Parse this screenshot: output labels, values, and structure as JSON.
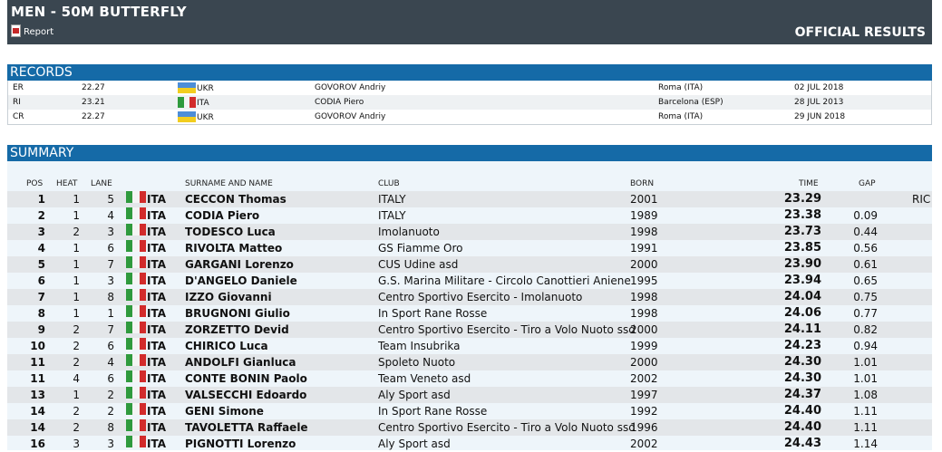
{
  "header": {
    "title": "MEN - 50M BUTTERFLY",
    "report_label": "Report",
    "official_label": "OFFICIAL RESULTS"
  },
  "records": {
    "title": "RECORDS",
    "rows": [
      {
        "type": "ER",
        "time": "22.27",
        "nat": "UKR",
        "name": "GOVOROV Andriy",
        "place": "Roma (ITA)",
        "date": "02 JUL 2018"
      },
      {
        "type": "RI",
        "time": "23.21",
        "nat": "ITA",
        "name": "CODIA Piero",
        "place": "Barcelona (ESP)",
        "date": "28 JUL 2013"
      },
      {
        "type": "CR",
        "time": "22.27",
        "nat": "UKR",
        "name": "GOVOROV Andriy",
        "place": "Roma (ITA)",
        "date": "29 JUN 2018"
      }
    ]
  },
  "summary": {
    "title": "SUMMARY",
    "columns": {
      "pos": "POS",
      "heat": "HEAT",
      "lane": "LANE",
      "name": "SURNAME AND NAME",
      "club": "CLUB",
      "born": "BORN",
      "time": "TIME",
      "gap": "GAP"
    },
    "rows": [
      {
        "pos": "1",
        "heat": "1",
        "lane": "5",
        "nat": "ITA",
        "name": "CECCON Thomas",
        "club": "ITALY",
        "born": "2001",
        "time": "23.29",
        "gap": "",
        "note": "RIC"
      },
      {
        "pos": "2",
        "heat": "1",
        "lane": "4",
        "nat": "ITA",
        "name": "CODIA Piero",
        "club": "ITALY",
        "born": "1989",
        "time": "23.38",
        "gap": "0.09",
        "note": ""
      },
      {
        "pos": "3",
        "heat": "2",
        "lane": "3",
        "nat": "ITA",
        "name": "TODESCO Luca",
        "club": "Imolanuoto",
        "born": "1998",
        "time": "23.73",
        "gap": "0.44",
        "note": ""
      },
      {
        "pos": "4",
        "heat": "1",
        "lane": "6",
        "nat": "ITA",
        "name": "RIVOLTA Matteo",
        "club": "GS Fiamme Oro",
        "born": "1991",
        "time": "23.85",
        "gap": "0.56",
        "note": ""
      },
      {
        "pos": "5",
        "heat": "1",
        "lane": "7",
        "nat": "ITA",
        "name": "GARGANI Lorenzo",
        "club": "CUS Udine asd",
        "born": "2000",
        "time": "23.90",
        "gap": "0.61",
        "note": ""
      },
      {
        "pos": "6",
        "heat": "1",
        "lane": "3",
        "nat": "ITA",
        "name": "D'ANGELO Daniele",
        "club": "G.S. Marina Militare - Circolo Canottieri Aniene",
        "born": "1995",
        "time": "23.94",
        "gap": "0.65",
        "note": ""
      },
      {
        "pos": "7",
        "heat": "1",
        "lane": "8",
        "nat": "ITA",
        "name": "IZZO Giovanni",
        "club": "Centro Sportivo Esercito - Imolanuoto",
        "born": "1998",
        "time": "24.04",
        "gap": "0.75",
        "note": ""
      },
      {
        "pos": "8",
        "heat": "1",
        "lane": "1",
        "nat": "ITA",
        "name": "BRUGNONI Giulio",
        "club": "In Sport Rane Rosse",
        "born": "1998",
        "time": "24.06",
        "gap": "0.77",
        "note": ""
      },
      {
        "pos": "9",
        "heat": "2",
        "lane": "7",
        "nat": "ITA",
        "name": "ZORZETTO Devid",
        "club": "Centro Sportivo Esercito - Tiro a Volo Nuoto ssd",
        "born": "2000",
        "time": "24.11",
        "gap": "0.82",
        "note": ""
      },
      {
        "pos": "10",
        "heat": "2",
        "lane": "6",
        "nat": "ITA",
        "name": "CHIRICO Luca",
        "club": "Team Insubrika",
        "born": "1999",
        "time": "24.23",
        "gap": "0.94",
        "note": ""
      },
      {
        "pos": "11",
        "heat": "2",
        "lane": "4",
        "nat": "ITA",
        "name": "ANDOLFI Gianluca",
        "club": "Spoleto Nuoto",
        "born": "2000",
        "time": "24.30",
        "gap": "1.01",
        "note": ""
      },
      {
        "pos": "11",
        "heat": "4",
        "lane": "6",
        "nat": "ITA",
        "name": "CONTE BONIN Paolo",
        "club": "Team Veneto asd",
        "born": "2002",
        "time": "24.30",
        "gap": "1.01",
        "note": ""
      },
      {
        "pos": "13",
        "heat": "1",
        "lane": "2",
        "nat": "ITA",
        "name": "VALSECCHI Edoardo",
        "club": "Aly Sport asd",
        "born": "1997",
        "time": "24.37",
        "gap": "1.08",
        "note": ""
      },
      {
        "pos": "14",
        "heat": "2",
        "lane": "2",
        "nat": "ITA",
        "name": "GENI Simone",
        "club": "In Sport Rane Rosse",
        "born": "1992",
        "time": "24.40",
        "gap": "1.11",
        "note": ""
      },
      {
        "pos": "14",
        "heat": "2",
        "lane": "8",
        "nat": "ITA",
        "name": "TAVOLETTA Raffaele",
        "club": "Centro Sportivo Esercito - Tiro a Volo Nuoto ssd",
        "born": "1996",
        "time": "24.40",
        "gap": "1.11",
        "note": ""
      },
      {
        "pos": "16",
        "heat": "3",
        "lane": "3",
        "nat": "ITA",
        "name": "PIGNOTTI Lorenzo",
        "club": "Aly Sport asd",
        "born": "2002",
        "time": "24.43",
        "gap": "1.14",
        "note": ""
      }
    ]
  }
}
